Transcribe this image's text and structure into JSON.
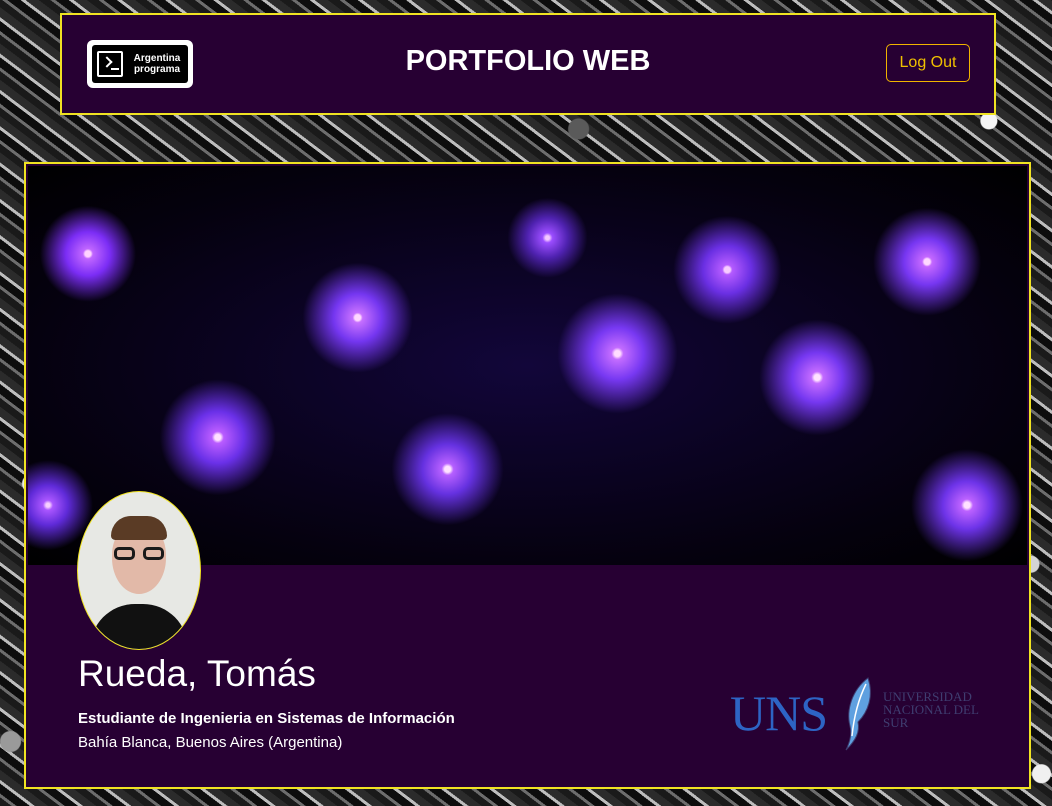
{
  "navbar": {
    "logo_text": "Argentina programa",
    "title": "PORTFOLIO WEB",
    "logout_label": "Log Out"
  },
  "profile": {
    "name": "Rueda, Tomás",
    "degree": "Estudiante de Ingenieria en Sistemas de Información",
    "location": "Bahía Blanca, Buenos Aires (Argentina)"
  },
  "university": {
    "abbr": "UNS",
    "name": "UNIVERSIDAD NACIONAL DEL SUR"
  },
  "colors": {
    "panel_bg": "#270033",
    "border_yellow": "#f0e322",
    "logout_text": "#f0c000",
    "uns_blue": "#2d64c4"
  }
}
